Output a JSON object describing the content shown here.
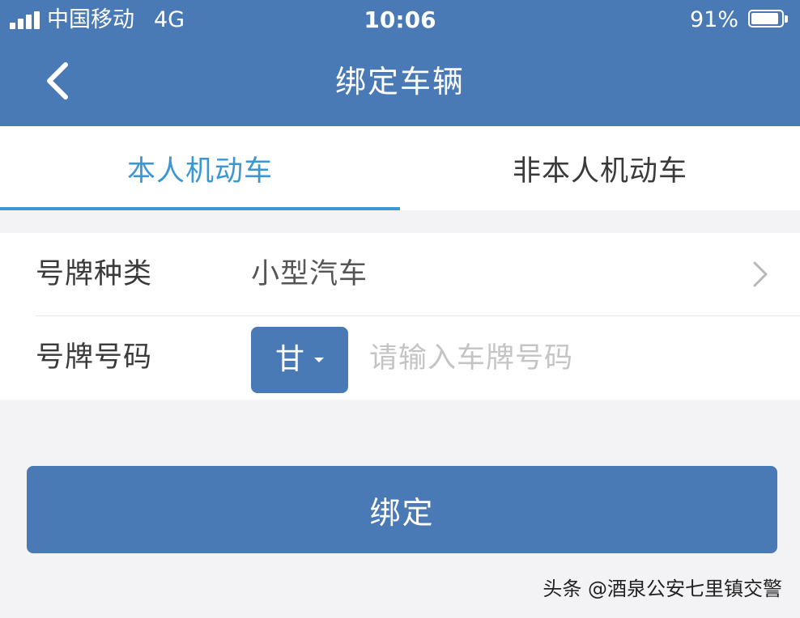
{
  "status_bar": {
    "carrier": "中国移动",
    "network": "4G",
    "time": "10:06",
    "battery_percent": "91%",
    "battery_level": 0.91
  },
  "nav": {
    "title": "绑定车辆",
    "back_icon": "chevron-left-icon"
  },
  "tabs": [
    {
      "label": "本人机动车",
      "active": true
    },
    {
      "label": "非本人机动车",
      "active": false
    }
  ],
  "form": {
    "plate_type": {
      "label": "号牌种类",
      "value": "小型汽车",
      "icon": "chevron-right-icon"
    },
    "plate_number": {
      "label": "号牌号码",
      "province": "甘",
      "placeholder": "请输入车牌号码",
      "value": ""
    }
  },
  "bind_button": {
    "label": "绑定"
  },
  "watermark": {
    "text": "头条 @酒泉公安七里镇交警"
  },
  "colors": {
    "primary": "#4a7ab5",
    "tab_active": "#3a97d6",
    "background": "#f3f3f5",
    "surface": "#ffffff"
  }
}
